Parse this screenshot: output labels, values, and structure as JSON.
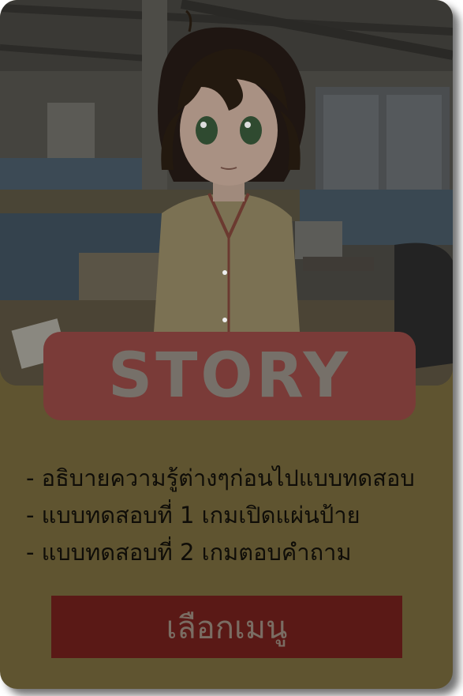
{
  "card": {
    "title": "STORY",
    "description_lines": [
      "- อธิบายความรู้ต่างๆก่อนไปแบบทดสอบ",
      "- แบบทดสอบที่ 1 เกมเปิดแผ่นป้าย",
      "- แบบทดสอบที่ 2 เกมตอบคำถาม"
    ],
    "menu_button_label": "เลือกเมนู"
  },
  "colors": {
    "card_background": "#5f5430",
    "title_badge": "#7a3b38",
    "menu_button": "#5a1916"
  }
}
